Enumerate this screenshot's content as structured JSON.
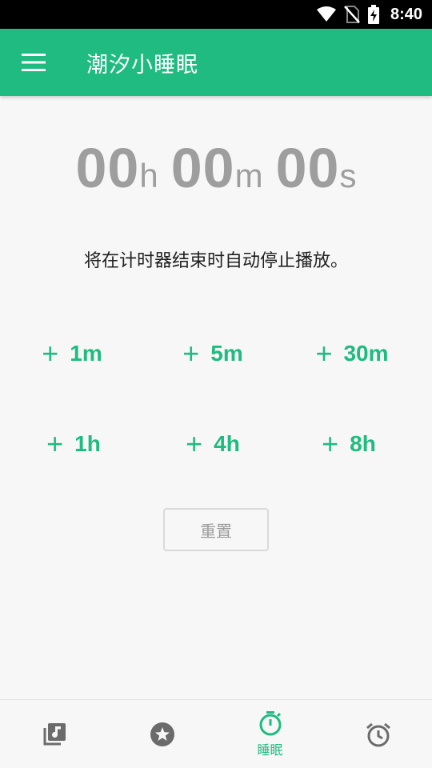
{
  "status_bar": {
    "time": "8:40"
  },
  "app_bar": {
    "title": "潮汐小睡眠"
  },
  "timer": {
    "hours": "00",
    "hours_unit": "h",
    "minutes": "00",
    "minutes_unit": "m",
    "seconds": "00",
    "seconds_unit": "s"
  },
  "hint": "将在计时器结束时自动停止播放。",
  "add_buttons": [
    {
      "plus": "+",
      "label": "1m"
    },
    {
      "plus": "+",
      "label": "5m"
    },
    {
      "plus": "+",
      "label": "30m"
    },
    {
      "plus": "+",
      "label": "1h"
    },
    {
      "plus": "+",
      "label": "4h"
    },
    {
      "plus": "+",
      "label": "8h"
    }
  ],
  "reset_label": "重置",
  "bottom_nav": {
    "items": [
      {
        "icon": "music-library-icon",
        "label": ""
      },
      {
        "icon": "star-icon",
        "label": ""
      },
      {
        "icon": "stopwatch-icon",
        "label": "睡眠"
      },
      {
        "icon": "alarm-clock-icon",
        "label": ""
      }
    ]
  },
  "colors": {
    "accent": "#1fbb80",
    "timer_text": "#9e9e9e",
    "icon_gray": "#6b6b6b"
  }
}
